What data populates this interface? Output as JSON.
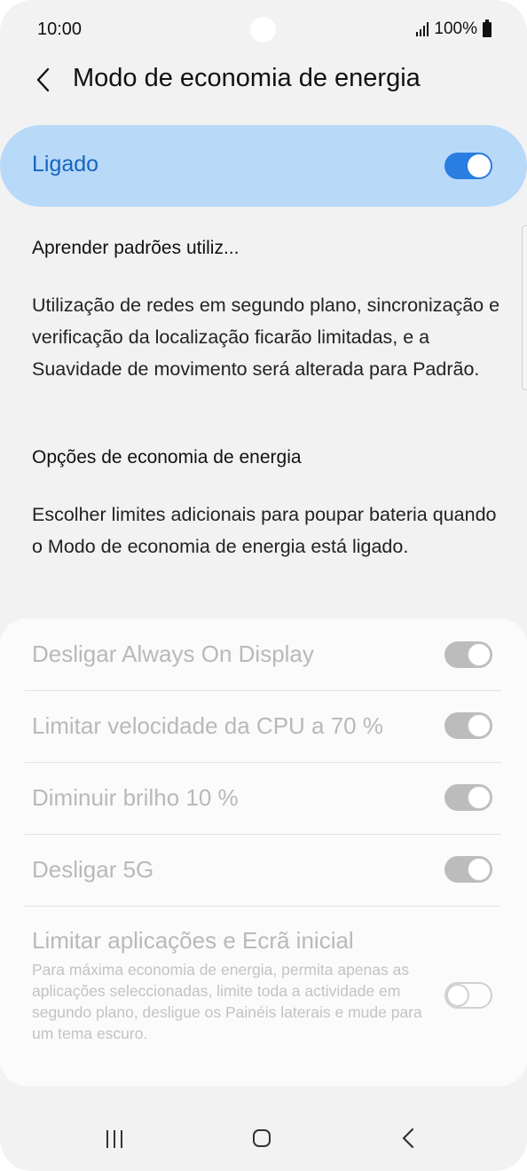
{
  "status_bar": {
    "time": "10:00",
    "battery": "100%"
  },
  "header": {
    "title": "Modo de economia de energia",
    "back_icon": "chevron-left-icon"
  },
  "master": {
    "label": "Ligado",
    "state": "on",
    "accent_color": "#2a7de1"
  },
  "learn": {
    "heading": "Aprender padrões utiliz...",
    "description": "Utilização de redes em segundo plano, sincronização e verificação da localização ficarão limitadas, e a Suavidade de movimento será alterada para Padrão."
  },
  "options_section": {
    "heading": "Opções de economia de energia",
    "description": "Escolher limites adicionais para poupar bateria quando o Modo de economia de energia está ligado."
  },
  "options": [
    {
      "label": "Desligar Always On Display",
      "state": "on",
      "disabled": true
    },
    {
      "label": "Limitar velocidade da CPU a 70 %",
      "state": "on",
      "disabled": true
    },
    {
      "label": "Diminuir brilho 10 %",
      "state": "on",
      "disabled": true
    },
    {
      "label": "Desligar 5G",
      "state": "on",
      "disabled": true
    },
    {
      "label": "Limitar aplicações e Ecrã inicial",
      "sublabel": "Para máxima economia de energia, permita apenas as aplicações seleccionadas, limite toda a actividade em segundo plano, desligue os Painéis laterais e mude para um tema escuro.",
      "state": "off",
      "disabled": true
    }
  ],
  "nav": {
    "recent_icon": "recent-apps-icon",
    "home_icon": "home-icon",
    "back_icon": "back-icon"
  }
}
